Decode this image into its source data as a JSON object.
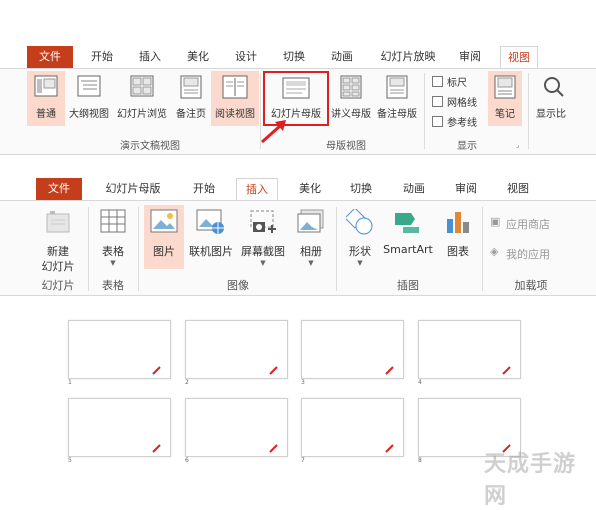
{
  "ribbon1": {
    "tabs": [
      "文件",
      "开始",
      "插入",
      "美化",
      "设计",
      "切换",
      "动画",
      "幻灯片放映",
      "审阅",
      "视图"
    ],
    "buttons": {
      "normal": "普通",
      "outline": "大纲视图",
      "sorter": "幻灯片浏览",
      "notes_page": "备注页",
      "reading": "阅读视图",
      "slide_master": "幻灯片母版",
      "handout_master": "讲义母版",
      "notes_master": "备注母版",
      "ruler": "标尺",
      "gridlines": "网格线",
      "guides": "参考线",
      "notes": "笔记",
      "display": "显示比"
    },
    "groups": {
      "presentation_views": "演示文稿视图",
      "master_views": "母版视图",
      "show": "显示"
    }
  },
  "ribbon2": {
    "tabs": [
      "文件",
      "幻灯片母版",
      "开始",
      "插入",
      "美化",
      "切换",
      "动画",
      "审阅",
      "视图"
    ],
    "buttons": {
      "new_slide": "新建",
      "new_slide_2": "幻灯片",
      "table": "表格",
      "picture": "图片",
      "online_picture": "联机图片",
      "screenshot": "屏幕截图",
      "album": "相册",
      "shapes": "形状",
      "smartart": "SmartArt",
      "chart": "图表",
      "store": "应用商店",
      "my_apps": "我的应用"
    },
    "groups": {
      "slides": "幻灯片",
      "tables": "表格",
      "images": "图像",
      "illustrations": "插图",
      "addins": "加载项"
    }
  },
  "thumbnails": [
    "1",
    "2",
    "3",
    "4",
    "5",
    "6",
    "7",
    "8"
  ],
  "watermark": "天成手游网",
  "colors": {
    "accent": "#c43e1c",
    "highlight": "#fbd9cc",
    "callout": "#e02020"
  }
}
